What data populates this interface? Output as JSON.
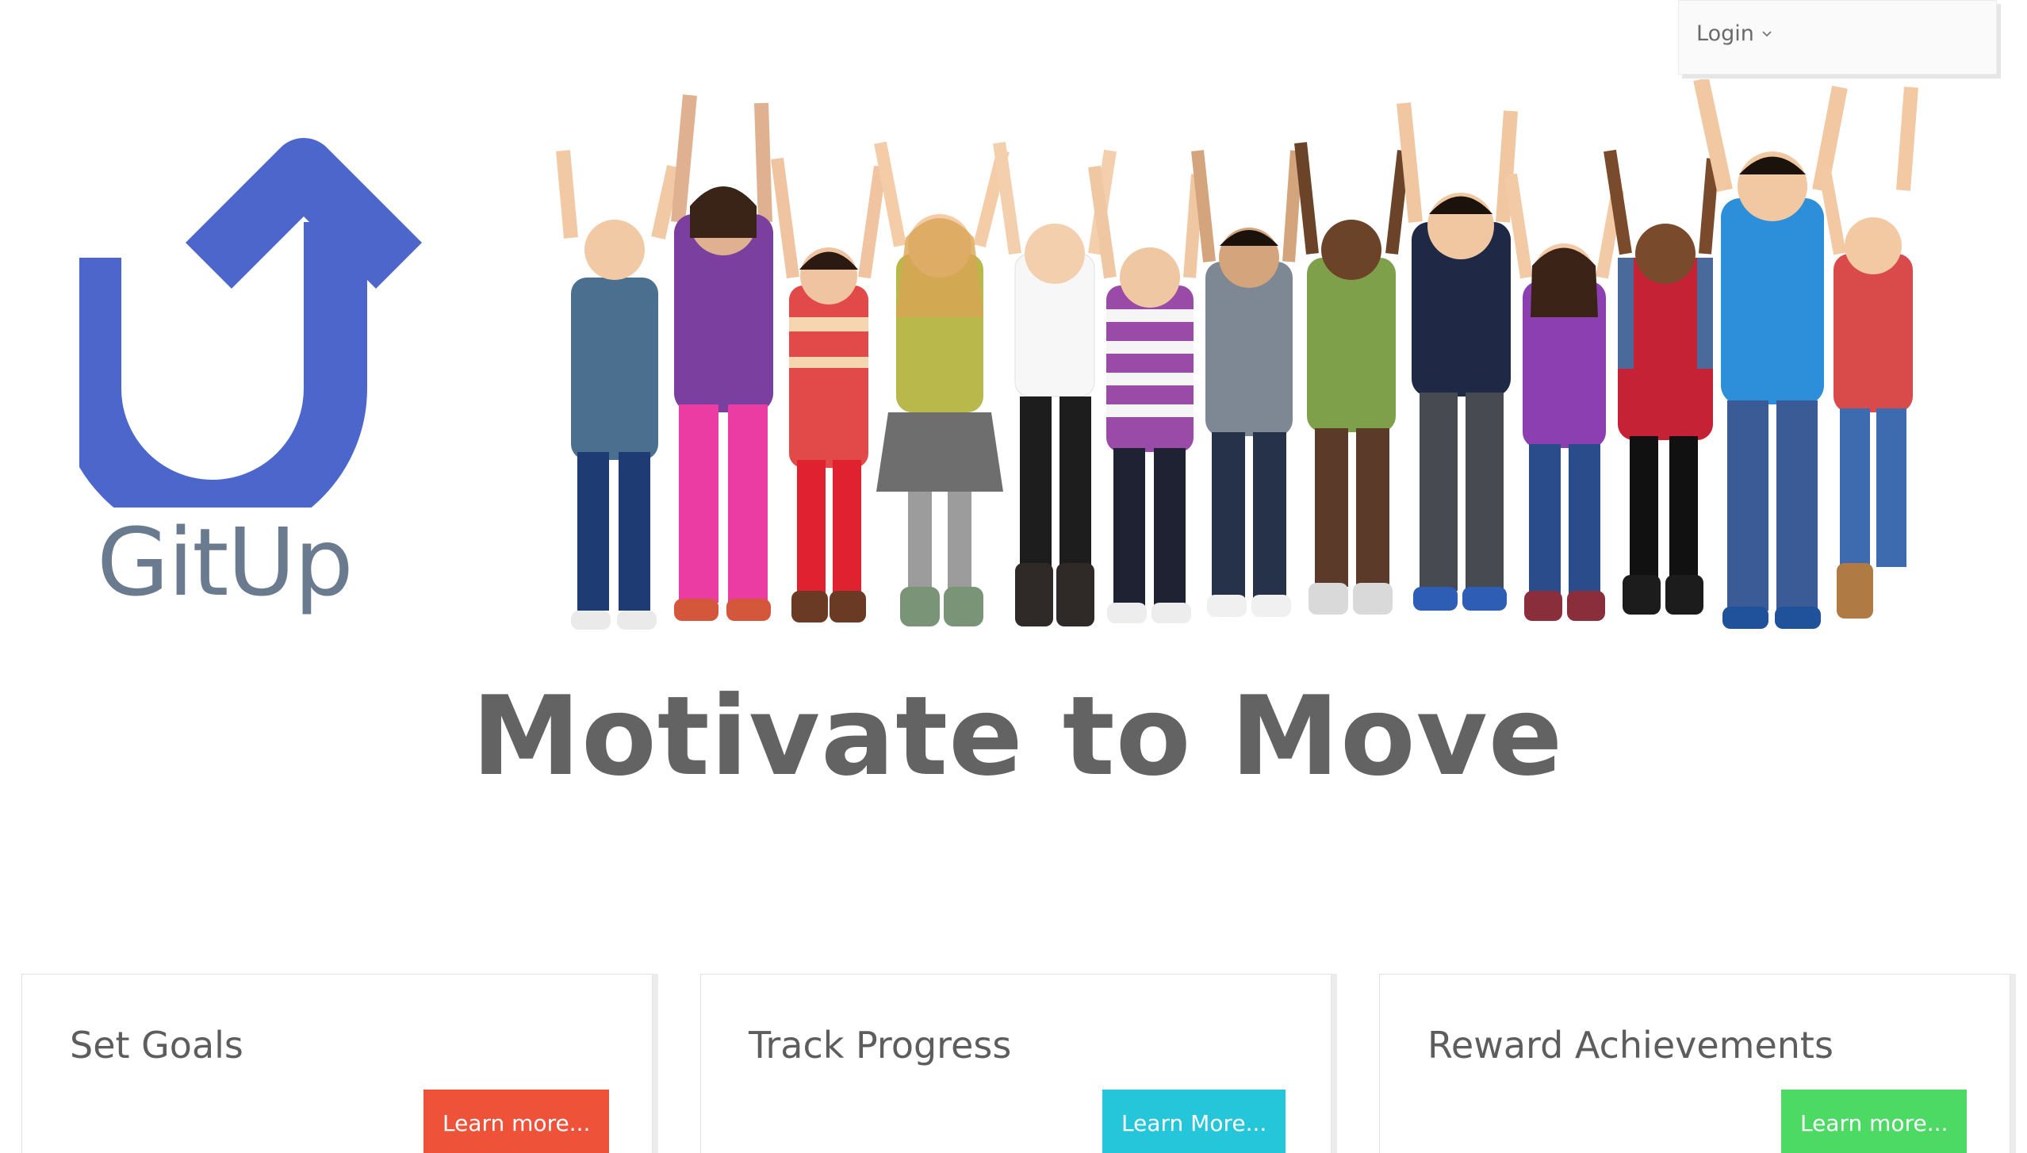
{
  "header": {
    "login_label": "Login"
  },
  "logo": {
    "text": "GitUp",
    "icon": "up-turn-arrow-icon",
    "color": "#4c66cc",
    "text_color": "#6b7b8f"
  },
  "hero": {
    "headline": "Motivate to Move",
    "image": "group-of-children-raising-arms-image"
  },
  "features": [
    {
      "title": "Set Goals",
      "button_label": "Learn more...",
      "button_color": "#ee533a"
    },
    {
      "title": "Track Progress",
      "button_label": "Learn More...",
      "button_color": "#26c6da"
    },
    {
      "title": "Reward Achievements",
      "button_label": "Learn more...",
      "button_color": "#4cd964"
    }
  ]
}
